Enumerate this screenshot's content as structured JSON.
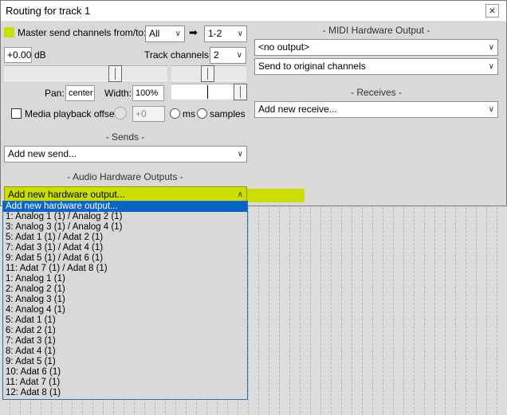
{
  "window": {
    "title": "Routing for track 1",
    "close_glyph": "×"
  },
  "master": {
    "label": "Master send channels from/to:",
    "from_value": "All",
    "arrow_glyph": "➡",
    "to_value": "1-2"
  },
  "volume": {
    "value": "+0.00",
    "unit": "dB"
  },
  "track_channels": {
    "label": "Track channels:",
    "value": "2"
  },
  "pan": {
    "label": "Pan:",
    "value": "center"
  },
  "width": {
    "label": "Width:",
    "value": "100%"
  },
  "media_offset": {
    "label": "Media playback offset:",
    "value": "+0",
    "unit_ms": "ms",
    "unit_samples": "samples"
  },
  "sends": {
    "section_label": "- Sends -",
    "combo_value": "Add new send..."
  },
  "audio_hw": {
    "section_label": "- Audio Hardware Outputs -",
    "combo_value": "Add new hardware output..."
  },
  "midi_hw": {
    "section_label": "- MIDI Hardware Output -",
    "output_value": "<no output>",
    "channels_value": "Send to original channels"
  },
  "receives": {
    "section_label": "- Receives -",
    "combo_value": "Add new receive..."
  },
  "dropdown_items": [
    "Add new hardware output...",
    "1: Analog 1 (1) / Analog 2 (1)",
    "3: Analog 3 (1) / Analog 4 (1)",
    "5: Adat 1 (1) / Adat 2 (1)",
    "7: Adat 3 (1) / Adat 4 (1)",
    "9: Adat 5 (1) / Adat 6 (1)",
    "11: Adat 7 (1) / Adat 8 (1)",
    "1: Analog 1 (1)",
    "2: Analog 2 (1)",
    "3: Analog 3 (1)",
    "4: Analog 4 (1)",
    "5: Adat 1 (1)",
    "6: Adat 2 (1)",
    "7: Adat 3 (1)",
    "8: Adat 4 (1)",
    "9: Adat 5 (1)",
    "10: Adat 6 (1)",
    "11: Adat 7 (1)",
    "12: Adat 8 (1)"
  ],
  "colors": {
    "highlight": "#ccdd00",
    "selection": "#0a64c8"
  }
}
